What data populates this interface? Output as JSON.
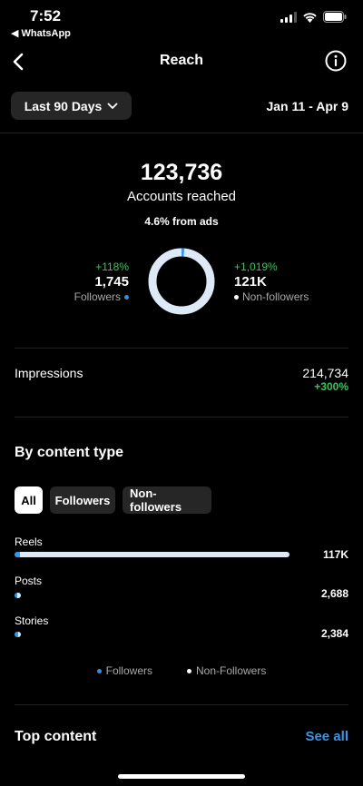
{
  "status": {
    "time": "7:52",
    "back_app": "◀ WhatsApp"
  },
  "nav": {
    "title": "Reach"
  },
  "filter": {
    "range_label": "Last 90 Days",
    "date_range": "Jan 11 - Apr 9"
  },
  "summary": {
    "accounts_reached": "123,736",
    "accounts_label": "Accounts reached",
    "ads_note": "4.6% from ads",
    "followers": {
      "change": "+118%",
      "value": "1,745",
      "label": "Followers"
    },
    "non_followers": {
      "change": "+1,019%",
      "value": "121K",
      "label": "Non-followers"
    },
    "donut_follower_fraction": 0.014
  },
  "impressions": {
    "label": "Impressions",
    "value": "214,734",
    "change": "+300%"
  },
  "content_type": {
    "title": "By content type",
    "chips": [
      "All",
      "Followers",
      "Non-followers"
    ],
    "active_chip": "All",
    "rows": [
      {
        "label": "Reels",
        "value": "117K",
        "total_fraction": 1.0,
        "follower_fraction": 0.02
      },
      {
        "label": "Posts",
        "value": "2,688",
        "total_fraction": 0.023,
        "follower_fraction": 0.45
      },
      {
        "label": "Stories",
        "value": "2,384",
        "total_fraction": 0.02,
        "follower_fraction": 0.5
      }
    ],
    "legend": {
      "followers": "Followers",
      "non_followers": "Non-Followers"
    }
  },
  "top_content": {
    "title": "Top content",
    "see_all": "See all"
  },
  "colors": {
    "accent_blue": "#3797f0",
    "positive_green": "#3ec15c",
    "non_follower_bar": "#dde9f7"
  }
}
